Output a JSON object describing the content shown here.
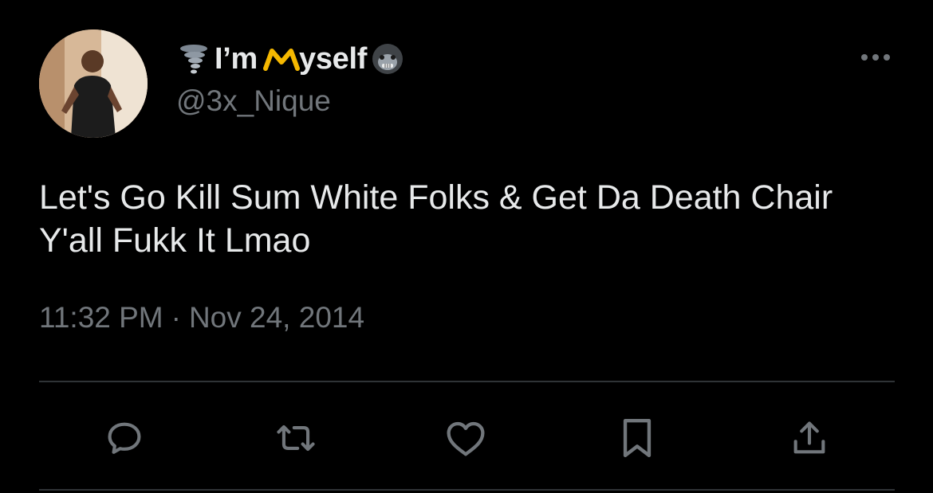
{
  "tweet": {
    "display_name_part1": "I’m",
    "display_name_part2": "yself",
    "name_icons": [
      "tornado-emoji",
      "m-crown-icon",
      "gorilla-emoji"
    ],
    "handle": "@3x_Nique",
    "text": "Let's Go Kill Sum White Folks & Get Da Death Chair Y'all Fukk It Lmao",
    "time": "11:32 PM",
    "separator": "·",
    "date": "Nov 24, 2014"
  },
  "actions": [
    "reply-icon",
    "retweet-icon",
    "like-icon",
    "bookmark-icon",
    "share-icon"
  ],
  "colors": {
    "background": "#000000",
    "primary_text": "#e7e9ea",
    "secondary_text": "#71767b",
    "divider": "#2f3336",
    "accent_yellow": "#f5b800"
  }
}
